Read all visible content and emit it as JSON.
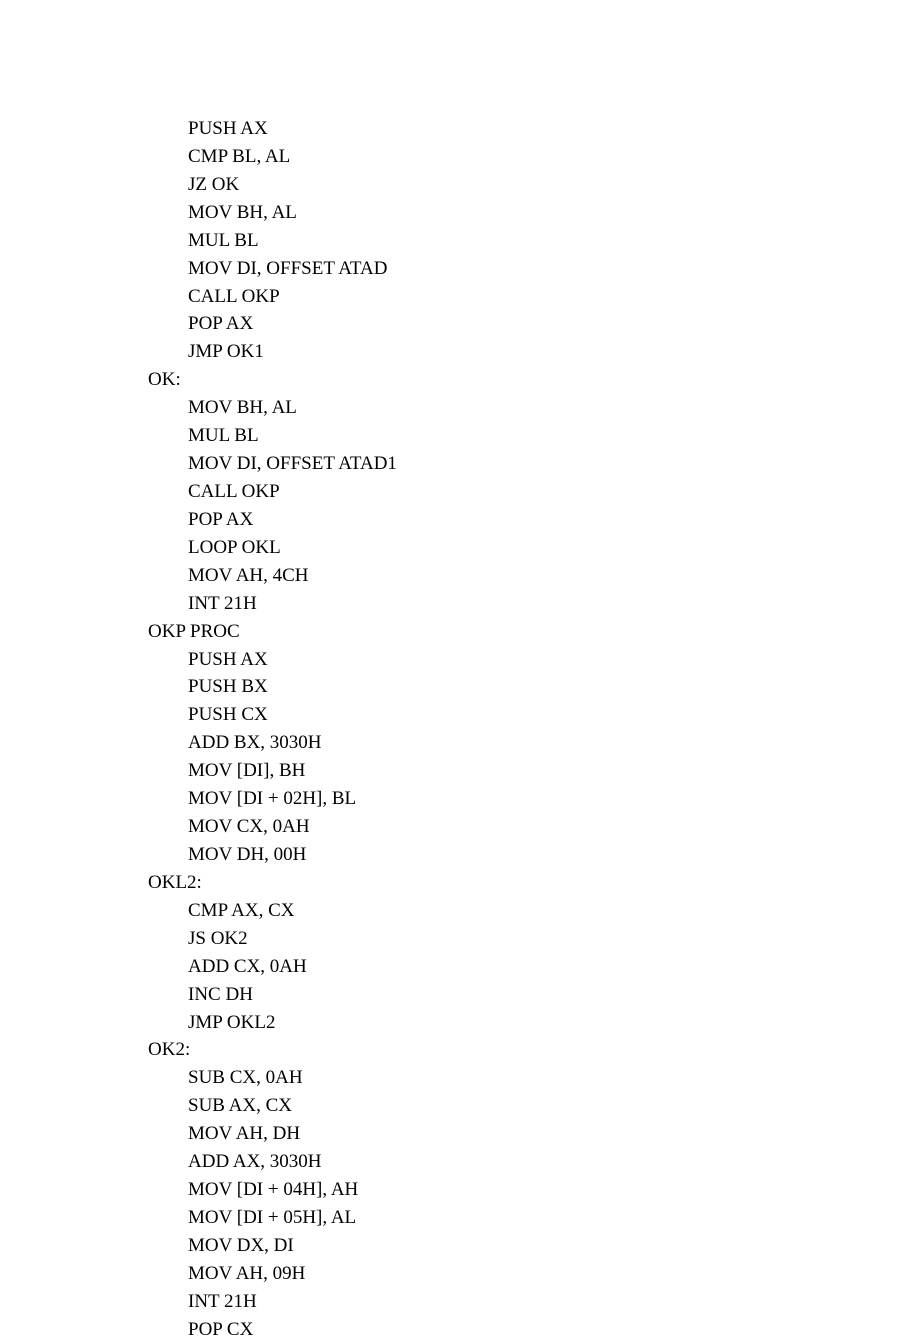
{
  "code": {
    "lines": [
      {
        "indent": true,
        "text": "PUSH AX"
      },
      {
        "indent": true,
        "text": "CMP BL, AL"
      },
      {
        "indent": true,
        "text": "JZ OK"
      },
      {
        "indent": true,
        "text": "MOV BH, AL"
      },
      {
        "indent": true,
        "text": "MUL BL"
      },
      {
        "indent": true,
        "text": "MOV DI, OFFSET ATAD"
      },
      {
        "indent": true,
        "text": "CALL OKP"
      },
      {
        "indent": true,
        "text": "POP AX"
      },
      {
        "indent": true,
        "text": "JMP OK1"
      },
      {
        "indent": false,
        "text": "OK:"
      },
      {
        "indent": true,
        "text": "MOV BH, AL"
      },
      {
        "indent": true,
        "text": "MUL BL"
      },
      {
        "indent": true,
        "text": "MOV DI, OFFSET ATAD1"
      },
      {
        "indent": true,
        "text": "CALL OKP"
      },
      {
        "indent": true,
        "text": "POP AX"
      },
      {
        "indent": true,
        "text": "LOOP OKL"
      },
      {
        "indent": true,
        "text": "MOV AH, 4CH"
      },
      {
        "indent": true,
        "text": "INT 21H"
      },
      {
        "indent": false,
        "text": "OKP PROC"
      },
      {
        "indent": true,
        "text": "PUSH AX"
      },
      {
        "indent": true,
        "text": "PUSH BX"
      },
      {
        "indent": true,
        "text": "PUSH CX"
      },
      {
        "indent": true,
        "text": "ADD BX, 3030H"
      },
      {
        "indent": true,
        "text": "MOV [DI], BH"
      },
      {
        "indent": true,
        "text": "MOV [DI + 02H], BL"
      },
      {
        "indent": true,
        "text": "MOV CX, 0AH"
      },
      {
        "indent": true,
        "text": "MOV DH, 00H"
      },
      {
        "indent": false,
        "text": "OKL2:"
      },
      {
        "indent": true,
        "text": "CMP AX, CX"
      },
      {
        "indent": true,
        "text": "JS OK2"
      },
      {
        "indent": true,
        "text": "ADD CX, 0AH"
      },
      {
        "indent": true,
        "text": "INC DH"
      },
      {
        "indent": true,
        "text": "JMP OKL2"
      },
      {
        "indent": false,
        "text": "OK2:"
      },
      {
        "indent": true,
        "text": "SUB CX, 0AH"
      },
      {
        "indent": true,
        "text": "SUB AX, CX"
      },
      {
        "indent": true,
        "text": "MOV AH, DH"
      },
      {
        "indent": true,
        "text": "ADD AX, 3030H"
      },
      {
        "indent": true,
        "text": "MOV [DI + 04H], AH"
      },
      {
        "indent": true,
        "text": "MOV [DI + 05H], AL"
      },
      {
        "indent": true,
        "text": "MOV DX, DI"
      },
      {
        "indent": true,
        "text": "MOV AH, 09H"
      },
      {
        "indent": true,
        "text": "INT 21H"
      },
      {
        "indent": true,
        "text": "POP CX"
      }
    ]
  }
}
